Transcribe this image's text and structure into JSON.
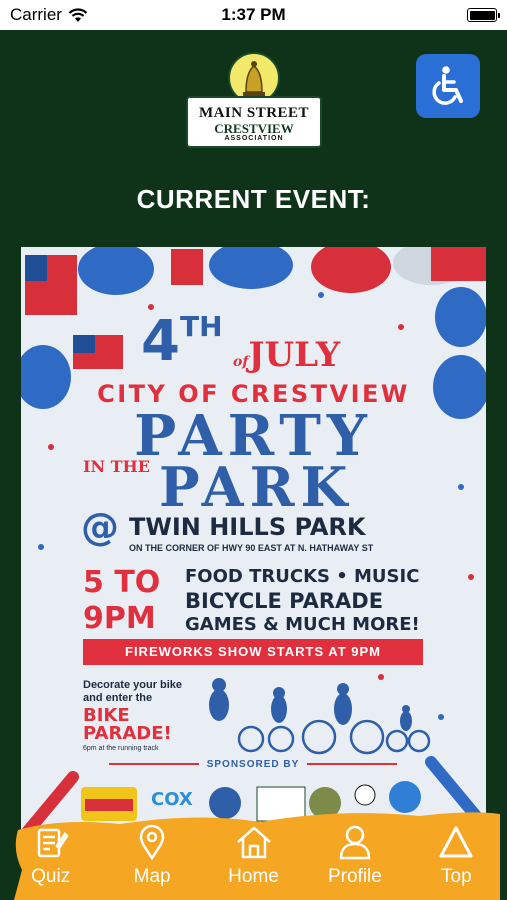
{
  "status_bar": {
    "carrier": "Carrier",
    "time": "1:37 PM",
    "battery_level": 1.0
  },
  "header": {
    "logo_line1": "MAIN STREET",
    "logo_line2": "CRESTVIEW",
    "logo_line3": "ASSOCIATION",
    "accessibility_icon": "wheelchair-icon"
  },
  "section_title": "CURRENT EVENT:",
  "poster": {
    "num": "4",
    "sup": "TH",
    "of": "of",
    "july": "JULY",
    "city": "CITY OF CRESTVIEW",
    "party": "PARTY",
    "in_the": "IN THE",
    "park": "PARK",
    "at": "@",
    "venue": "TWIN HILLS PARK",
    "corner": "ON THE CORNER OF HWY 90 EAST AT N. HATHAWAY ST",
    "time_line1": "5 TO",
    "time_line2": "9PM",
    "act1": "FOOD TRUCKS • MUSIC",
    "act2": "BICYCLE PARADE",
    "act3": "GAMES & MUCH MORE!",
    "fireworks": "FIREWORKS SHOW STARTS AT 9PM",
    "decorate": "Decorate your bike and enter the",
    "bike_parade": "BIKE PARADE!",
    "track": "6pm at the running track",
    "sponsored": "SPONSORED BY",
    "sponsor_cox": "COX"
  },
  "tabbar": {
    "accent": "#f5a623",
    "tabs": [
      {
        "label": "Quiz",
        "icon": "quiz-icon"
      },
      {
        "label": "Map",
        "icon": "map-pin-icon"
      },
      {
        "label": "Home",
        "icon": "home-icon"
      },
      {
        "label": "Profile",
        "icon": "profile-icon"
      },
      {
        "label": "Top",
        "icon": "top-icon"
      }
    ]
  }
}
